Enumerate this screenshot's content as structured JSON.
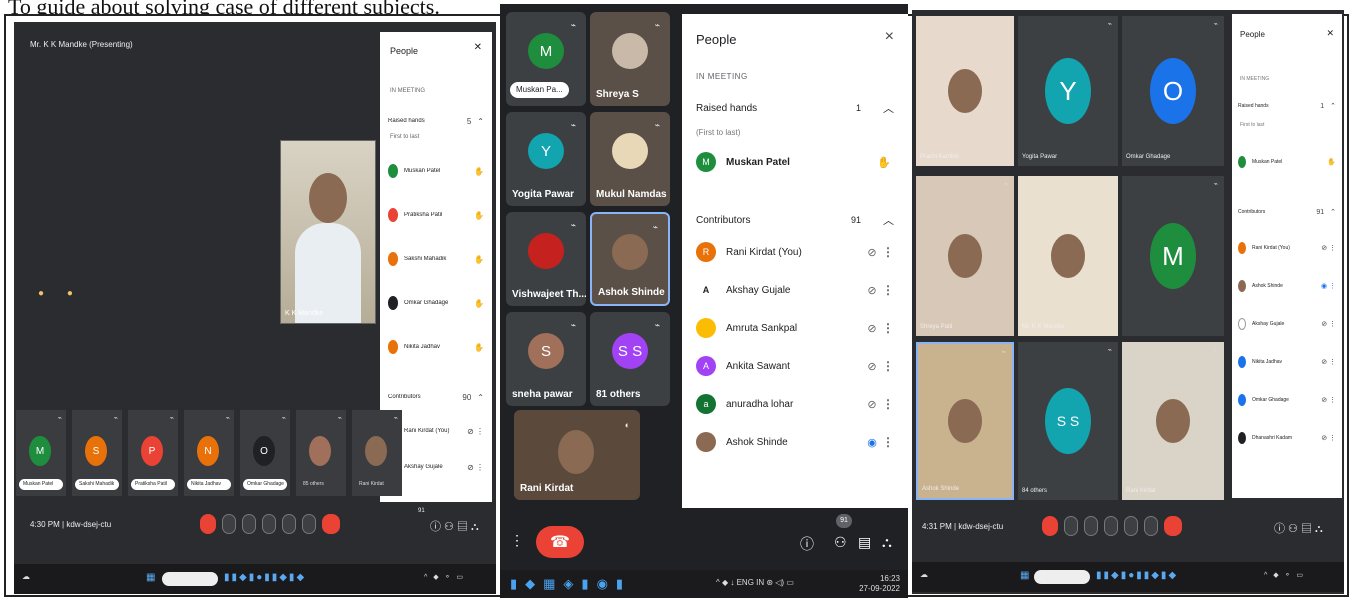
{
  "caption": "To guide about solving case of different subjects.",
  "colors": {
    "accent_blue": "#1a73e8",
    "hangup_red": "#ea4335",
    "tile_gray": "#3c4043",
    "meet_bg": "#202124",
    "avatar_green": "#1e8e3e",
    "avatar_teal": "#12a4af",
    "avatar_blue": "#1a73e8",
    "avatar_orange": "#e8710a",
    "avatar_purple": "#a142f4",
    "avatar_brown": "#a0705a"
  },
  "screenshot1": {
    "presenter_label": "Mr. K K Mandke (Presenting)",
    "tile_caption": "K K Mandke",
    "panel": {
      "title": "People",
      "section_label": "IN MEETING",
      "raised_hands_label": "Raised hands",
      "raised_hands_count": "5",
      "order_hint": "First to last",
      "raised": [
        {
          "name": "Muskan Patel",
          "icon": "raised-hand-icon"
        },
        {
          "name": "Pratiksha Patil",
          "icon": "raised-hand-icon"
        },
        {
          "name": "Sakshi Mahadik",
          "icon": "raised-hand-icon"
        },
        {
          "name": "Omkar Ghadage",
          "icon": "raised-hand-icon"
        },
        {
          "name": "Nikita Jadhav",
          "icon": "raised-hand-icon"
        }
      ],
      "contributors_label": "Contributors",
      "contributors_count": "90",
      "contributors": [
        {
          "name": "Rani Kirdat (You)",
          "icon": "mic-off-icon"
        },
        {
          "name": "Akshay Gujale",
          "icon": "mic-off-icon"
        }
      ]
    },
    "strip": [
      {
        "initial": "M",
        "name": "Muskan Patel",
        "color": "#1e8e3e"
      },
      {
        "initial": "S",
        "name": "Sakshi Mahadik",
        "color": "#e8710a"
      },
      {
        "initial": "P",
        "name": "Pratiksha Patil",
        "color": "#ea4335"
      },
      {
        "initial": "N",
        "name": "Nikita Jadhav",
        "color": "#e8710a"
      },
      {
        "initial": "O",
        "name": "Omkar Ghadage",
        "color": "#202124"
      },
      {
        "initial": "",
        "name": "85 others",
        "color": "#a0705a"
      },
      {
        "initial": "",
        "name": "Rani Kirdat",
        "color": "#8a6a52"
      }
    ],
    "meeting_info": "4:30 PM | kdw-dsej-ctu",
    "people_badge": "91"
  },
  "screenshot2": {
    "tiles": [
      {
        "name": "Muskan Pa...",
        "initial": "M",
        "color": "#1e8e3e",
        "pill": true
      },
      {
        "name": "Shreya S",
        "initial": "",
        "color": "#c9b9a8",
        "pill": false
      },
      {
        "name": "Yogita Pawar",
        "initial": "Y",
        "color": "#12a4af",
        "pill": false
      },
      {
        "name": "Mukul Namdas",
        "initial": "",
        "color": "#e9d8b8",
        "pill": false
      },
      {
        "name": "Vishwajeet Th...",
        "initial": "",
        "color": "#c5221f",
        "pill": false
      },
      {
        "name": "Ashok Shinde",
        "initial": "",
        "color": "#8a6a52",
        "pill": false
      },
      {
        "name": "sneha pawar",
        "initial": "S",
        "color": "#a0705a",
        "pill": false
      },
      {
        "name": "81 others",
        "initial": "S S",
        "color": "#a142f4",
        "pill": false
      }
    ],
    "self_tile_name": "Rani Kirdat",
    "panel": {
      "title": "People",
      "close": "×",
      "section_label": "IN MEETING",
      "raised_hands_label": "Raised hands",
      "raised_hands_count": "1",
      "order_hint": "(First to last)",
      "raised": [
        {
          "initial": "M",
          "name": "Muskan Patel",
          "color": "#1e8e3e",
          "icon": "raised-hand-icon"
        }
      ],
      "contributors_label": "Contributors",
      "contributors_count": "91",
      "contributors": [
        {
          "initial": "R",
          "name": "Rani Kirdat (You)",
          "color": "#e8710a",
          "icon": "mic-off-icon"
        },
        {
          "initial": "A",
          "name": "Akshay Gujale",
          "color": "#ffffff",
          "icon": "mic-off-icon"
        },
        {
          "initial": "",
          "name": "Amruta Sankpal",
          "color": "#fbbc04",
          "icon": "mic-off-icon"
        },
        {
          "initial": "A",
          "name": "Ankita Sawant",
          "color": "#a142f4",
          "icon": "mic-off-icon"
        },
        {
          "initial": "a",
          "name": "anuradha lohar",
          "color": "#137333",
          "icon": "mic-off-icon"
        },
        {
          "initial": "",
          "name": "Ashok Shinde",
          "color": "#8a6a52",
          "icon": "speaking-icon"
        }
      ]
    },
    "people_badge": "91",
    "tray": "^ ◆ ↓ ENG IN ⊛ ◁) ▭",
    "clock_time": "16:23",
    "clock_date": "27-09-2022"
  },
  "screenshot3": {
    "tiles_top": [
      {
        "name": "Prachi Kamble",
        "initial": "",
        "color": "#e7d9cc"
      },
      {
        "name": "Yogita Pawar",
        "initial": "Y",
        "color": "#12a4af"
      },
      {
        "name": "Omkar Ghadage",
        "initial": "O",
        "color": "#1a73e8"
      }
    ],
    "tiles_mid": [
      {
        "name": "Shreya Patil",
        "initial": "",
        "color": "#d8c8b8"
      },
      {
        "name": "Mr. K K Mandke",
        "initial": "",
        "color": "#e9e0d0"
      },
      {
        "name": "",
        "initial": "M",
        "color": "#1e8e3e"
      }
    ],
    "tiles_bottom": [
      {
        "name": "Ashok Shinde",
        "initial": "",
        "color": "#c9b28e"
      },
      {
        "name": "84 others",
        "initial": "S S",
        "color": "#12a4af"
      },
      {
        "name": "Rani Kirdat",
        "initial": "",
        "color": "#d9d3c8"
      }
    ],
    "panel": {
      "title": "People",
      "section_label": "IN MEETING",
      "raised_hands_label": "Raised hands",
      "raised_hands_count": "1",
      "order_hint": "First to last",
      "raised": [
        {
          "name": "Muskan Patel",
          "color": "#1e8e3e",
          "icon": "raised-hand-icon"
        }
      ],
      "contributors_label": "Contributors",
      "contributors_count": "91",
      "contributors": [
        {
          "name": "Rani Kirdat (You)",
          "color": "#e8710a",
          "icon": "mic-off-icon"
        },
        {
          "name": "Ashok Shinde",
          "color": "#8a6a52",
          "icon": "speaking-icon"
        },
        {
          "name": "Akshay Gujale",
          "color": "#ffffff",
          "icon": "mic-off-icon"
        },
        {
          "name": "Nikita Jadhav",
          "color": "#1a73e8",
          "icon": "mic-off-icon"
        },
        {
          "name": "Omkar Ghadage",
          "color": "#1a73e8",
          "icon": "mic-off-icon"
        },
        {
          "name": "Dhanashri Kadam",
          "color": "#202124",
          "icon": "mic-off-icon"
        }
      ]
    },
    "meeting_info": "4:31 PM | kdw-dsej-ctu"
  }
}
